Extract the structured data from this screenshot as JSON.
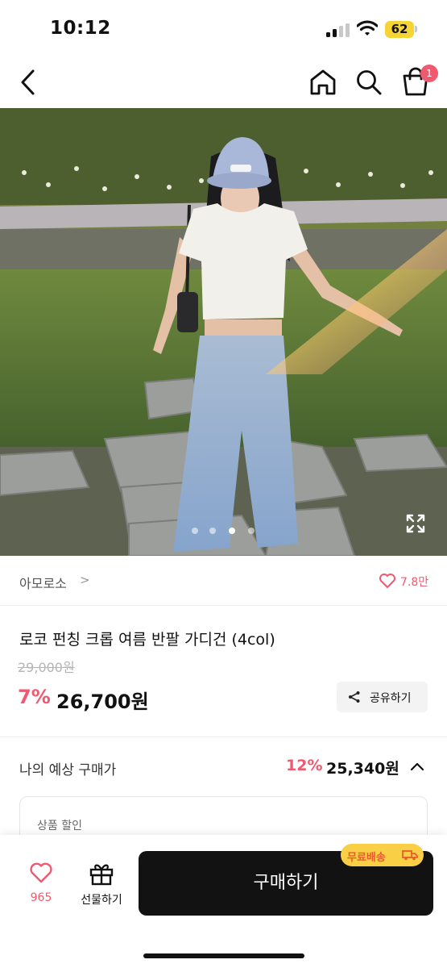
{
  "status_bar": {
    "time": "10:12",
    "battery": "62"
  },
  "nav": {
    "cart_count": "1"
  },
  "gallery": {
    "total_images": 4,
    "active_index": 2
  },
  "brand": {
    "name": "아모로소",
    "chevron": ">",
    "like_count": "7.8만"
  },
  "product": {
    "title": "로코 펀칭 크롭 여름 반팔 가디건 (4col)",
    "original_price": "29,000원",
    "discount_rate": "7%",
    "sale_price": "26,700원",
    "share_label": "공유하기"
  },
  "expected": {
    "label": "나의 예상 구매가",
    "rate": "12%",
    "price": "25,340원",
    "discount_box_label": "상품 할인"
  },
  "bottom_bar": {
    "wish_count": "965",
    "gift_label": "선물하기",
    "buy_label": "구매하기",
    "free_shipping_label": "무료배송"
  },
  "colors": {
    "accent": "#f05a70",
    "badge_yellow": "#f8cf45",
    "buy_button": "#121212"
  }
}
